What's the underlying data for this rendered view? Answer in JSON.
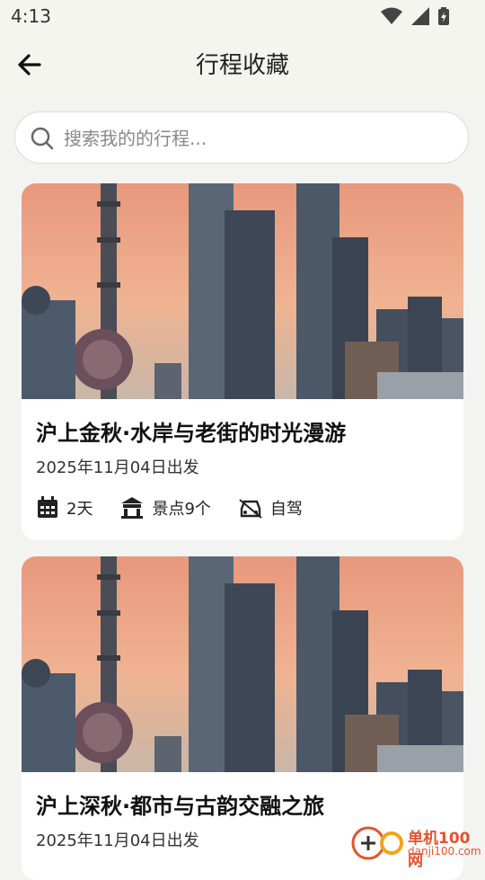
{
  "status": {
    "time": "4:13"
  },
  "appbar": {
    "title": "行程收藏"
  },
  "search": {
    "placeholder": "搜索我的的行程..."
  },
  "trips": [
    {
      "title": "沪上金秋·水岸与老街的时光漫游",
      "date": "2025年11月04日出发",
      "days": "2天",
      "spots": "景点9个",
      "transport": "自驾"
    },
    {
      "title": "沪上深秋·都市与古韵交融之旅",
      "date": "2025年11月04日出发"
    }
  ],
  "watermark": {
    "brand": "单机100网",
    "url": "danji100.com"
  },
  "colors": {
    "accent": "#e5522b",
    "appbar_bg": "#f4f5ef",
    "page_bg": "#f3f3f1"
  },
  "icons": [
    "wifi-icon",
    "signal-icon",
    "battery-icon",
    "back-arrow-icon",
    "search-icon",
    "calendar-icon",
    "building-icon",
    "car-icon"
  ]
}
